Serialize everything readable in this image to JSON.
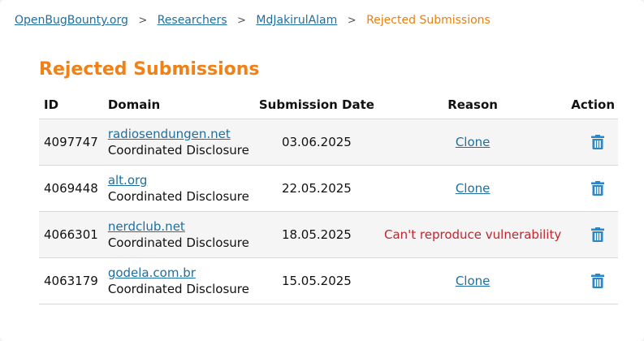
{
  "breadcrumb": {
    "items": [
      {
        "label": "OpenBugBounty.org"
      },
      {
        "label": "Researchers"
      },
      {
        "label": "MdJakirulAlam"
      }
    ],
    "current": "Rejected Submissions",
    "separator": ">"
  },
  "page_title": "Rejected Submissions",
  "table": {
    "headers": {
      "id": "ID",
      "domain": "Domain",
      "date": "Submission Date",
      "reason": "Reason",
      "action": "Action"
    },
    "rows": [
      {
        "id": "4097747",
        "domain": "radiosendungen.net",
        "type": "Coordinated Disclosure",
        "date": "03.06.2025",
        "reason": "Clone",
        "reason_is_link": true
      },
      {
        "id": "4069448",
        "domain": "alt.org",
        "type": "Coordinated Disclosure",
        "date": "22.05.2025",
        "reason": "Clone",
        "reason_is_link": true
      },
      {
        "id": "4066301",
        "domain": "nerdclub.net",
        "type": "Coordinated Disclosure",
        "date": "18.05.2025",
        "reason": "Can't reproduce vulnerability",
        "reason_is_link": false
      },
      {
        "id": "4063179",
        "domain": "godela.com.br",
        "type": "Coordinated Disclosure",
        "date": "15.05.2025",
        "reason": "Clone",
        "reason_is_link": true
      }
    ],
    "action_icon": "trash-icon"
  },
  "colors": {
    "link": "#1f6f9e",
    "title": "#ef8117",
    "breadcrumb_current": "#e8800f",
    "reason_error": "#c0262d",
    "icon": "#2b86c5"
  }
}
